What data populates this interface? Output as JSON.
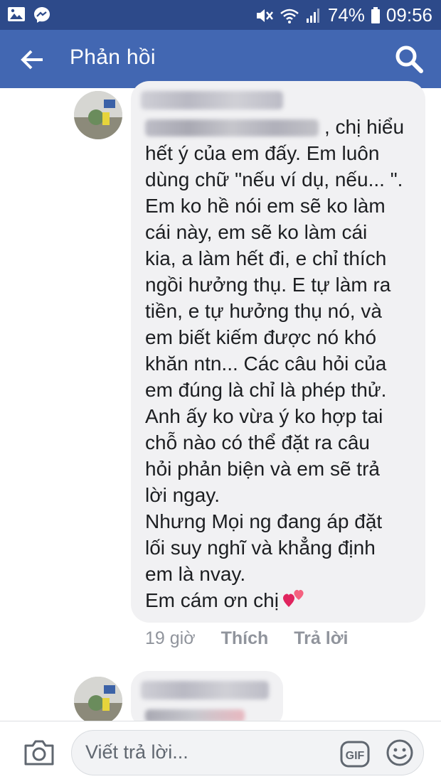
{
  "status_bar": {
    "battery_percent": "74%",
    "time": "09:56",
    "icons": [
      "gallery-icon",
      "messenger-icon",
      "mute-icon",
      "wifi-icon",
      "signal-icon",
      "battery-icon"
    ]
  },
  "app_bar": {
    "title": "Phản hồi",
    "back_icon": "arrow-left-icon",
    "search_icon": "search-icon",
    "background": "#4267b2"
  },
  "comment": {
    "text_first_line": ", chị hiểu",
    "text_rest": "hết ý của em đấy. Em luôn\ndùng chữ \"nếu ví dụ, nếu... \".\nEm ko hề nói em sẽ ko làm\ncái này, em sẽ ko làm cái\nkia, a làm hết đi, e chỉ thích\nngồi hưởng thụ. E tự làm ra\ntiền, e tự hưởng thụ nó, và\nem biết kiếm được nó khó\nkhăn ntn... Các câu hỏi của\nem đúng là chỉ là phép thử.\nAnh ấy ko vừa ý ko hợp tai\nchỗ nào có thể đặt ra câu\nhỏi phản biện và em sẽ trả\nlời ngay.\nNhưng Mọi ng đang áp đặt\nlối suy nghĩ và khẳng định\nem là nvay.",
    "last_line": "Em cám ơn chị",
    "reaction_emoji": "two-hearts-icon",
    "time": "19 giờ",
    "like_label": "Thích",
    "reply_label": "Trả lời"
  },
  "composer": {
    "placeholder": "Viết trả lời...",
    "camera_icon": "camera-icon",
    "gif_label": "GIF",
    "emoji_icon": "smiley-icon"
  }
}
